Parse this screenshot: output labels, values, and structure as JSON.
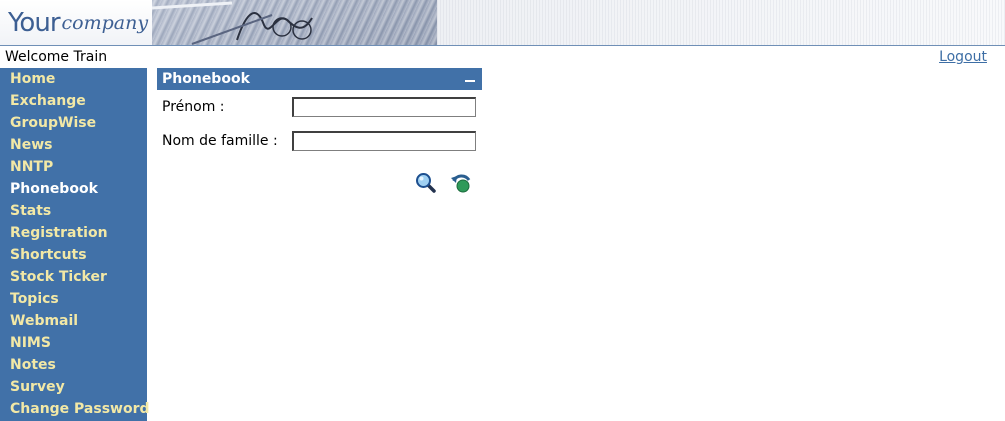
{
  "header": {
    "logo_word": "Your",
    "logo_suffix": "company"
  },
  "welcome": {
    "text": "Welcome Train",
    "logout_label": "Logout"
  },
  "sidebar": {
    "items": [
      {
        "label": "Home"
      },
      {
        "label": "Exchange"
      },
      {
        "label": "GroupWise"
      },
      {
        "label": "News"
      },
      {
        "label": "NNTP"
      },
      {
        "label": "Phonebook"
      },
      {
        "label": "Stats"
      },
      {
        "label": "Registration"
      },
      {
        "label": "Shortcuts"
      },
      {
        "label": "Stock Ticker"
      },
      {
        "label": "Topics"
      },
      {
        "label": "Webmail"
      },
      {
        "label": "NIMS"
      },
      {
        "label": "Notes"
      },
      {
        "label": "Survey"
      },
      {
        "label": "Change Password"
      }
    ],
    "active": "Phonebook"
  },
  "phonebook": {
    "title": "Phonebook",
    "first_name_label": "Prénom :",
    "first_name_value": "",
    "last_name_label": "Nom de famille :",
    "last_name_value": "",
    "search_icon": "search-magnifier-icon",
    "reset_icon": "reset-arrow-icon"
  },
  "colors": {
    "nav_bg": "#4171a8",
    "nav_text": "#f2e8a6",
    "nav_active_text": "#ffffff",
    "link": "#3d6ea5"
  }
}
